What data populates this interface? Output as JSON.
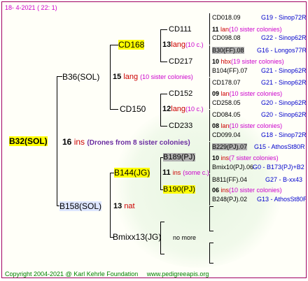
{
  "header": {
    "date": "18-   4-2021",
    "count": "(  22:   1)"
  },
  "footer": {
    "copyright": "Copyright 2004-2021 @ Karl Kehrle Foundation",
    "site": "www.pedigreeapis.org"
  },
  "root": {
    "id": "B32(SOL)",
    "num": "16",
    "word": "ins",
    "note": "(Drones from 8 sister colonies)"
  },
  "gen1": [
    {
      "id": "B36(SOL)",
      "num": "15",
      "word": "lang",
      "note": "(10 sister colonies)"
    },
    {
      "id": "B158(SOL)",
      "num": "13",
      "word": "nat"
    }
  ],
  "gen2": [
    {
      "id": "CD168",
      "num": "13",
      "word": "lang",
      "note": "(10 c.)"
    },
    {
      "id": "CD150",
      "num": "12",
      "word": "lang",
      "note": "(10 c.)"
    },
    {
      "id": "B144(JG)",
      "num": "11",
      "word": "ins",
      "note": "(some c.)"
    },
    {
      "id": "Bmixx13(JG)",
      "note": "no more"
    }
  ],
  "gen3": [
    {
      "id": "CD111",
      "num": "11",
      "word": "lan",
      "note": "(10 sister colonies)"
    },
    {
      "id": "CD217",
      "num": "10",
      "word": "hbx",
      "note": "(19 sister colonies)"
    },
    {
      "id": "CD152",
      "num": "09",
      "word": "lan",
      "note": "(10 sister colonies)"
    },
    {
      "id": "CD233",
      "num": "08",
      "word": "lan",
      "note": "(10 sister colonies)"
    },
    {
      "id": "B189(PJ)",
      "num": "10",
      "word": "ins",
      "note": "(7 sister colonies)"
    },
    {
      "id": "B190(PJ)",
      "num": "06",
      "word": "ins",
      "note": "(10 sister colonies)"
    }
  ],
  "gen4": [
    {
      "id": "CD018.09",
      "ref": "G19 - Sinop72R"
    },
    {
      "id": "CD098.08",
      "ref": "G22 - Sinop62R"
    },
    {
      "id": "B30(FF).08",
      "ref": "G16 - Longos77R"
    },
    {
      "id": "B104(FF).07",
      "ref": "G21 - Sinop62R"
    },
    {
      "id": "CD178.07",
      "ref": "G21 - Sinop62R"
    },
    {
      "id": "CD258.05",
      "ref": "G20 - Sinop62R"
    },
    {
      "id": "CD084.05",
      "ref": "G20 - Sinop62R"
    },
    {
      "id": "CD099.04",
      "ref": "G18 - Sinop72R"
    },
    {
      "id": "B229(PJ).07",
      "ref": "G15 - AthosSt80R"
    },
    {
      "id": "Bmix10(PJ).06",
      "ref": "G0 - B173(PJ)+B2"
    },
    {
      "id": "B811(FF).04",
      "ref": "G27 - B-xx43"
    },
    {
      "id": "B248(PJ).02",
      "ref": "G13 - AthosSt80R"
    }
  ]
}
